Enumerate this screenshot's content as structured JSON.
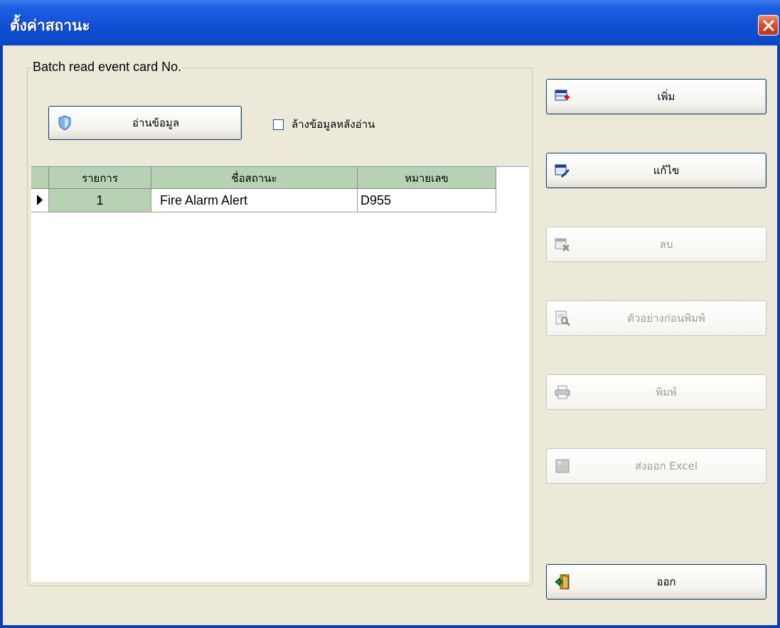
{
  "window": {
    "title": "ตั้งค่าสถานะ"
  },
  "group": {
    "title": "Batch read event card No.",
    "read_button": "อ่านข้อมูล",
    "clear_checkbox_label": "ล้างข้อมูลหลังอ่าน",
    "clear_checked": false
  },
  "grid": {
    "columns": [
      "รายการ",
      "ชื่อสถานะ",
      "หมายเลข"
    ],
    "rows": [
      {
        "index": "1",
        "name": "Fire Alarm Alert",
        "number": "D955"
      }
    ]
  },
  "actions": {
    "add": "เพิ่ม",
    "edit": "แก้ไข",
    "delete": "ลบ",
    "preview": "ตัวอย่างก่อนพิมพ์",
    "print": "พิมพ์",
    "export": "ส่งออก Excel",
    "exit": "ออก"
  },
  "colors": {
    "titlebar": "#0c48c8",
    "client_bg": "#ece9d8",
    "grid_header": "#b6d2b2",
    "close_button": "#d6462a"
  }
}
